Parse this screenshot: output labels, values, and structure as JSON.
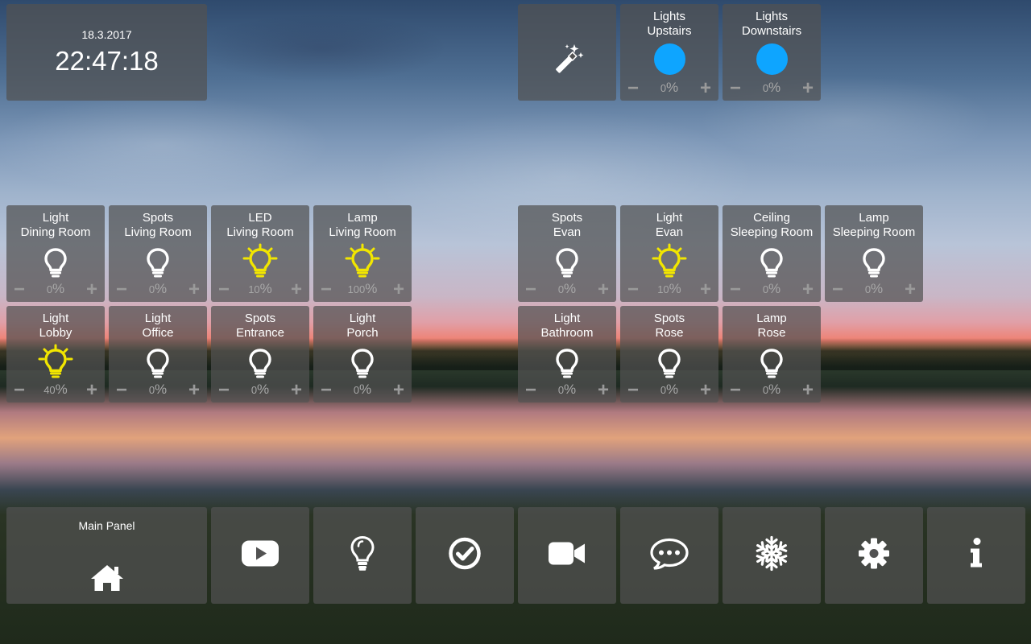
{
  "colors": {
    "tile_bg": "rgba(82,82,82,0.72)",
    "bulb_on": "#f2e600",
    "bulb_off": "#ffffff",
    "scene_dot": "#0ea5ff",
    "muted_text": "#a7a7a7"
  },
  "clock": {
    "date": "18.3.2017",
    "time": "22:47:18"
  },
  "scenes": [
    {
      "icon": "magic-wand-icon"
    },
    {
      "line1": "Lights",
      "line2": "Upstairs",
      "value": "0",
      "unit": "%",
      "minus": "−",
      "plus": "+"
    },
    {
      "line1": "Lights",
      "line2": "Downstairs",
      "value": "0",
      "unit": "%",
      "minus": "−",
      "plus": "+"
    }
  ],
  "lights": [
    {
      "line1": "Light",
      "line2": "Dining Room",
      "value": "0",
      "unit": "%",
      "on": false,
      "minus": "−",
      "plus": "+"
    },
    {
      "line1": "Spots",
      "line2": "Living Room",
      "value": "0",
      "unit": "%",
      "on": false,
      "minus": "−",
      "plus": "+"
    },
    {
      "line1": "LED",
      "line2": "Living Room",
      "value": "10",
      "unit": "%",
      "on": true,
      "minus": "−",
      "plus": "+"
    },
    {
      "line1": "Lamp",
      "line2": "Living Room",
      "value": "100",
      "unit": "%",
      "on": true,
      "minus": "−",
      "plus": "+"
    },
    {
      "line1": "Light",
      "line2": "Lobby",
      "value": "40",
      "unit": "%",
      "on": true,
      "minus": "−",
      "plus": "+"
    },
    {
      "line1": "Light",
      "line2": "Office",
      "value": "0",
      "unit": "%",
      "on": false,
      "minus": "−",
      "plus": "+"
    },
    {
      "line1": "Spots",
      "line2": "Entrance",
      "value": "0",
      "unit": "%",
      "on": false,
      "minus": "−",
      "plus": "+"
    },
    {
      "line1": "Light",
      "line2": "Porch",
      "value": "0",
      "unit": "%",
      "on": false,
      "minus": "−",
      "plus": "+"
    },
    {
      "line1": "Spots",
      "line2": "Evan",
      "value": "0",
      "unit": "%",
      "on": false,
      "minus": "−",
      "plus": "+"
    },
    {
      "line1": "Light",
      "line2": "Evan",
      "value": "10",
      "unit": "%",
      "on": true,
      "minus": "−",
      "plus": "+"
    },
    {
      "line1": "Ceiling",
      "line2": "Sleeping Room",
      "value": "0",
      "unit": "%",
      "on": false,
      "minus": "−",
      "plus": "+"
    },
    {
      "line1": "Lamp",
      "line2": "Sleeping Room",
      "value": "0",
      "unit": "%",
      "on": false,
      "minus": "−",
      "plus": "+"
    },
    {
      "line1": "Light",
      "line2": "Bathroom",
      "value": "0",
      "unit": "%",
      "on": false,
      "minus": "−",
      "plus": "+"
    },
    {
      "line1": "Spots",
      "line2": "Rose",
      "value": "0",
      "unit": "%",
      "on": false,
      "minus": "−",
      "plus": "+"
    },
    {
      "line1": "Lamp",
      "line2": "Rose",
      "value": "0",
      "unit": "%",
      "on": false,
      "minus": "−",
      "plus": "+"
    }
  ],
  "nav": [
    {
      "label": "Main Panel",
      "icon": "home-icon"
    },
    {
      "icon": "youtube-play-icon"
    },
    {
      "icon": "lightbulb-icon"
    },
    {
      "icon": "check-circle-icon"
    },
    {
      "icon": "video-camera-icon"
    },
    {
      "icon": "chat-bubble-icon"
    },
    {
      "icon": "snowflake-icon"
    },
    {
      "icon": "gear-icon"
    },
    {
      "icon": "info-icon"
    }
  ]
}
